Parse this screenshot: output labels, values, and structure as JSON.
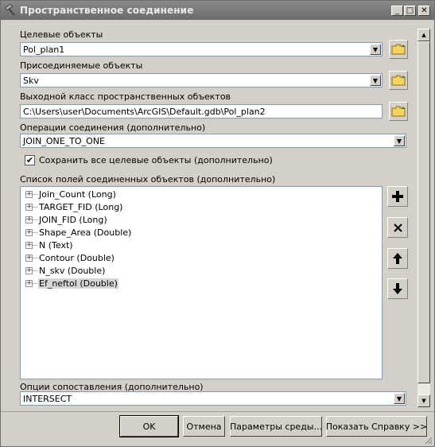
{
  "window": {
    "title": "Пространственное соединение",
    "controls": {
      "minimize": "_",
      "maximize": "□",
      "close": "✕"
    }
  },
  "fields": {
    "target_label": "Целевые объекты",
    "target_value": "Pol_plan1",
    "join_label": "Присоединяемые объекты",
    "join_value": "Skv",
    "output_label": "Выходной класс пространственных объектов",
    "output_value": "C:\\Users\\user\\Documents\\ArcGIS\\Default.gdb\\Pol_plan2",
    "operation_label": "Операции соединения (дополнительно)",
    "operation_value": "JOIN_ONE_TO_ONE",
    "keep_all_label": "Сохранить все целевые объекты (дополнительно)",
    "keep_all_checked": true,
    "field_map_label": "Список полей соединенных объектов (дополнительно)",
    "field_map_items": [
      "Join_Count (Long)",
      "TARGET_FID (Long)",
      "JOIN_FID (Long)",
      "Shape_Area (Double)",
      "N (Text)",
      "Contour (Double)",
      "N_skv (Double)",
      "Ef_neftol (Double)"
    ],
    "match_label": "Опции сопоставления (дополнительно)",
    "match_value": "INTERSECT"
  },
  "side_buttons": {
    "add": "plus-icon",
    "remove": "x-icon",
    "up": "arrow-up-icon",
    "down": "arrow-down-icon"
  },
  "buttons": {
    "ok": "OK",
    "cancel": "Отмена",
    "env": "Параметры среды...",
    "help": "Показать Справку >>"
  }
}
